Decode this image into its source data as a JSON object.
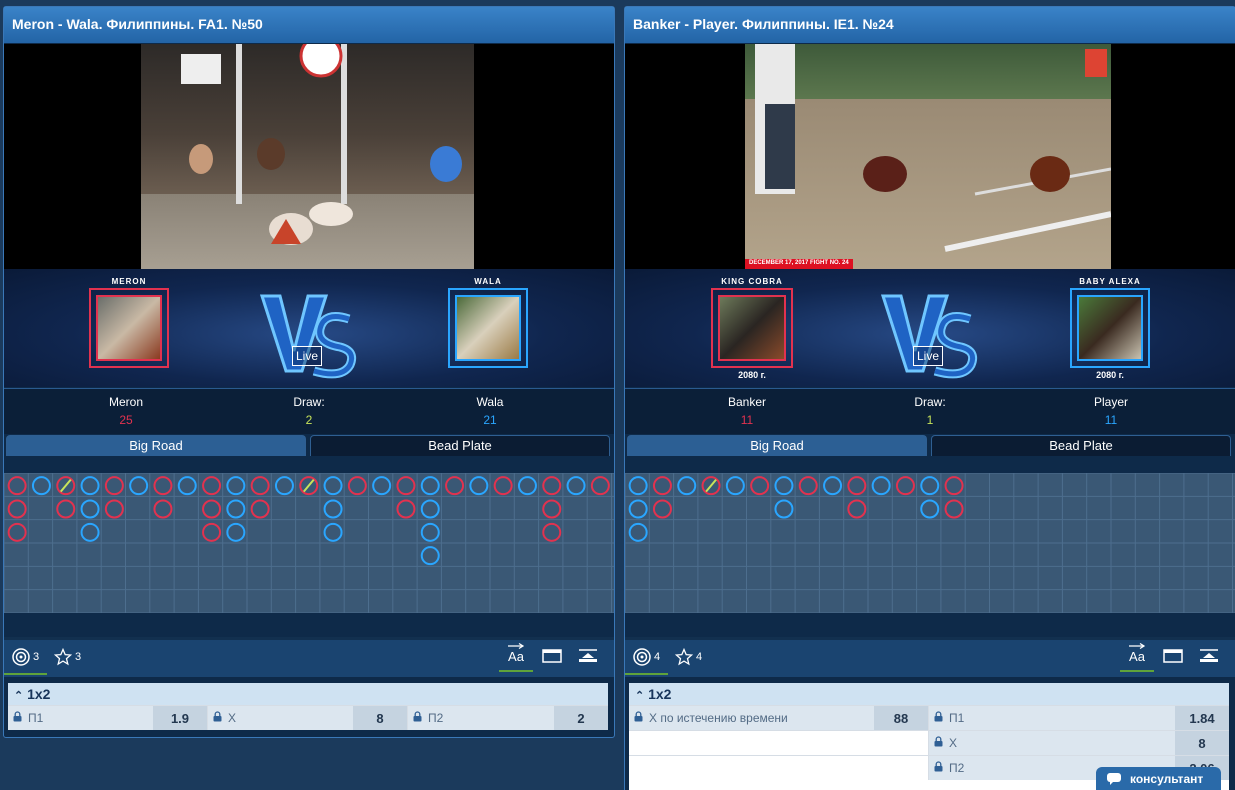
{
  "colors": {
    "red": "#e2324f",
    "blue": "#2aa6ff",
    "draw": "#c7e45a"
  },
  "panels": [
    {
      "title": "Meron - Wala. Филиппины. FA1. №50",
      "fighters": [
        {
          "name": "MERON",
          "year": ""
        },
        {
          "name": "WALA",
          "year": ""
        }
      ],
      "live": "Live",
      "score": {
        "left_label": "Meron",
        "left_value": "25",
        "draw_label": "Draw:",
        "draw_value": "2",
        "right_label": "Wala",
        "right_value": "21"
      },
      "tabs": [
        "Big Road",
        "Bead Plate"
      ],
      "big_road": [
        [
          "R",
          "R",
          "R"
        ],
        [
          "B"
        ],
        [
          "RT",
          "R"
        ],
        [
          "B",
          "B",
          "B"
        ],
        [
          "R",
          "R"
        ],
        [
          "B"
        ],
        [
          "R",
          "R"
        ],
        [
          "B"
        ],
        [
          "R",
          "R",
          "R"
        ],
        [
          "B",
          "B",
          "B"
        ],
        [
          "R",
          "R"
        ],
        [
          "B"
        ],
        [
          "RT"
        ],
        [
          "B",
          "B",
          "B"
        ],
        [
          "R"
        ],
        [
          "B"
        ],
        [
          "R",
          "R"
        ],
        [
          "B",
          "B",
          "B",
          "B"
        ],
        [
          "R"
        ],
        [
          "B"
        ],
        [
          "R"
        ],
        [
          "B"
        ],
        [
          "R",
          "R",
          "R"
        ],
        [
          "B"
        ],
        [
          "R"
        ]
      ],
      "toolbar": {
        "target_count": "3",
        "star_count": "3",
        "font_icon": "Aa"
      },
      "market": {
        "title": "1x2",
        "rows": [
          [
            {
              "label": "П1",
              "odd": "1.9"
            },
            {
              "label": "X",
              "odd": "8"
            },
            {
              "label": "П2",
              "odd": "2"
            }
          ]
        ]
      }
    },
    {
      "title": "Banker - Player. Филиппины. IE1. №24",
      "video_caption": "DECEMBER 17, 2017 FIGHT NO. 24",
      "fighters": [
        {
          "name": "KING COBRA",
          "year": "2080 г."
        },
        {
          "name": "BABY ALEXA",
          "year": "2080 г."
        }
      ],
      "live": "Live",
      "score": {
        "left_label": "Banker",
        "left_value": "11",
        "draw_label": "Draw:",
        "draw_value": "1",
        "right_label": "Player",
        "right_value": "11"
      },
      "tabs": [
        "Big Road",
        "Bead Plate"
      ],
      "big_road": [
        [
          "B",
          "B",
          "B"
        ],
        [
          "R",
          "R"
        ],
        [
          "B"
        ],
        [
          "RT"
        ],
        [
          "B"
        ],
        [
          "R"
        ],
        [
          "B",
          "B"
        ],
        [
          "R"
        ],
        [
          "B"
        ],
        [
          "R",
          "R"
        ],
        [
          "B"
        ],
        [
          "R"
        ],
        [
          "B",
          "B"
        ],
        [
          "R",
          "R"
        ]
      ],
      "toolbar": {
        "target_count": "4",
        "star_count": "4",
        "font_icon": "Aa"
      },
      "market": {
        "title": "1x2",
        "left_row": {
          "label": "X по истечению времени",
          "odd": "88"
        },
        "right_rows": [
          {
            "label": "П1",
            "odd": "1.84"
          },
          {
            "label": "X",
            "odd": "8"
          },
          {
            "label": "П2",
            "odd": "2.06"
          }
        ]
      }
    }
  ],
  "consultant": {
    "label": "консультант"
  }
}
